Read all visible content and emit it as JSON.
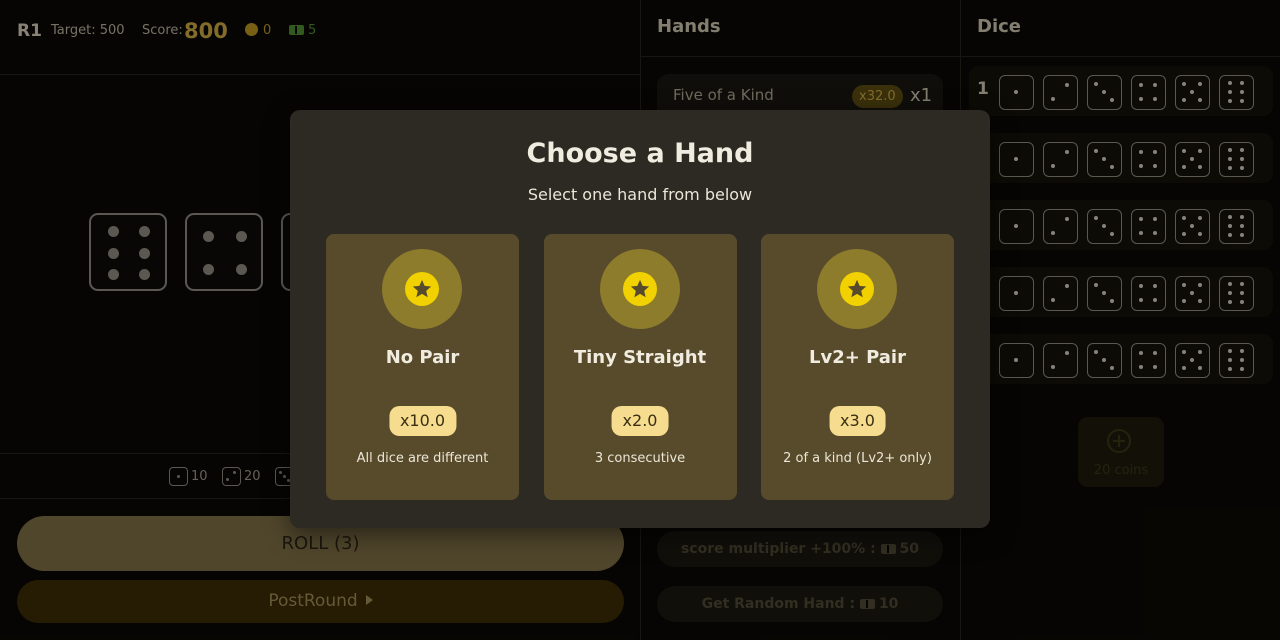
{
  "topbar": {
    "round": "R1",
    "target_label": "Target: 500",
    "score_label": "Score:",
    "score_value": "800",
    "coins": "0",
    "tickets": "5"
  },
  "board": {
    "dice_faces": [
      6,
      4,
      1
    ],
    "scores": [
      {
        "face": 1,
        "value": "10"
      },
      {
        "face": 2,
        "value": "20"
      },
      {
        "face": 3,
        "value": ""
      }
    ]
  },
  "buttons": {
    "roll": "ROLL (3)",
    "post_round": "PostRound"
  },
  "hands": {
    "title": "Hands",
    "items": [
      {
        "name": "Five of a Kind",
        "mult": "x32.0",
        "level": "x1"
      }
    ],
    "shop": [
      {
        "label": "score multiplier +100% :",
        "cost": "50"
      },
      {
        "label": "Get Random Hand :",
        "cost": "10"
      }
    ]
  },
  "dice_panel": {
    "title": "Dice",
    "rows": [
      {
        "index": "1",
        "faces": [
          1,
          2,
          3,
          4,
          5,
          6
        ]
      },
      {
        "index": "",
        "faces": [
          1,
          2,
          3,
          4,
          5,
          6
        ]
      },
      {
        "index": "",
        "faces": [
          1,
          2,
          3,
          4,
          5,
          6
        ]
      },
      {
        "index": "",
        "faces": [
          1,
          2,
          3,
          4,
          5,
          6
        ]
      },
      {
        "index": "",
        "faces": [
          1,
          2,
          3,
          4,
          5,
          6
        ]
      }
    ],
    "add_slot_label": "20 coins"
  },
  "modal": {
    "title": "Choose a Hand",
    "subtitle": "Select one hand from below",
    "options": [
      {
        "name": "No Pair",
        "mult": "x10.0",
        "desc": "All dice are different",
        "icon": "star-icon"
      },
      {
        "name": "Tiny Straight",
        "mult": "x2.0",
        "desc": "3 consecutive",
        "icon": "star-icon"
      },
      {
        "name": "Lv2+ Pair",
        "mult": "x3.0",
        "desc": "2 of a kind (Lv2+ only)",
        "icon": "star-icon"
      }
    ]
  },
  "colors": {
    "accent_gold": "#c9a640",
    "coin": "#b89223",
    "ticket": "#4e8a30",
    "card_bg": "#584b2b",
    "modal_bg": "#2d2a24"
  }
}
